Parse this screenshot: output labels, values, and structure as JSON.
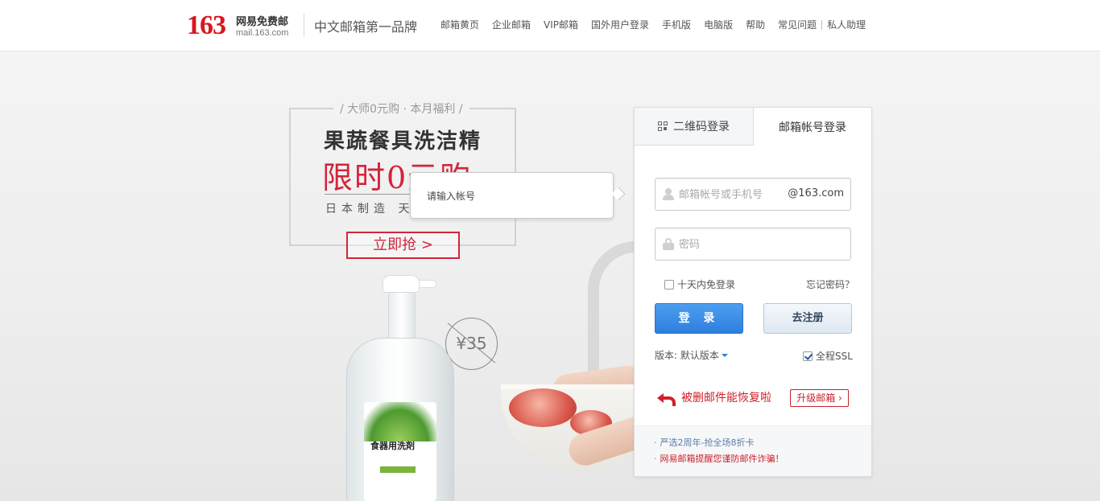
{
  "header": {
    "logo_number": "163",
    "logo_cn": "网易免费邮",
    "logo_url": "mail.163.com",
    "slogan": "中文邮箱第一品牌",
    "nav": [
      "邮箱黄页",
      "企业邮箱",
      "VIP邮箱",
      "国外用户登录",
      "手机版",
      "电脑版",
      "帮助",
      "常见问题"
    ],
    "nav_extra": "私人助理"
  },
  "promo": {
    "subtitle": "/ 大师0元购 · 本月福利 /",
    "title": "果蔬餐具洗洁精",
    "highlight": "限时0元购",
    "origin": "日本制造 天然",
    "cta": "立即抢 >",
    "price": "¥35",
    "bottle_label": "食器用洗剤"
  },
  "tooltip": {
    "text": "请输入帐号"
  },
  "login": {
    "tab_qr": "二维码登录",
    "tab_account": "邮箱帐号登录",
    "username_placeholder": "邮箱帐号或手机号",
    "domain": "@163.com",
    "password_placeholder": "密码",
    "remember_label": "十天内免登录",
    "forgot_label": "忘记密码？",
    "login_button": "登 录",
    "register_button": "去注册",
    "version_label": "版本: 默认版本",
    "ssl_label": "全程SSL",
    "recover_text": "被删邮件能恢复啦",
    "upgrade_button": "升级邮箱 ›",
    "footer_links": [
      "严选2周年-抢全场8折卡",
      "网易邮箱提醒您谨防邮件诈骗！"
    ]
  },
  "colors": {
    "brand_red": "#d7181e",
    "primary_blue": "#2d7fdd",
    "promo_red": "#d3243a"
  }
}
